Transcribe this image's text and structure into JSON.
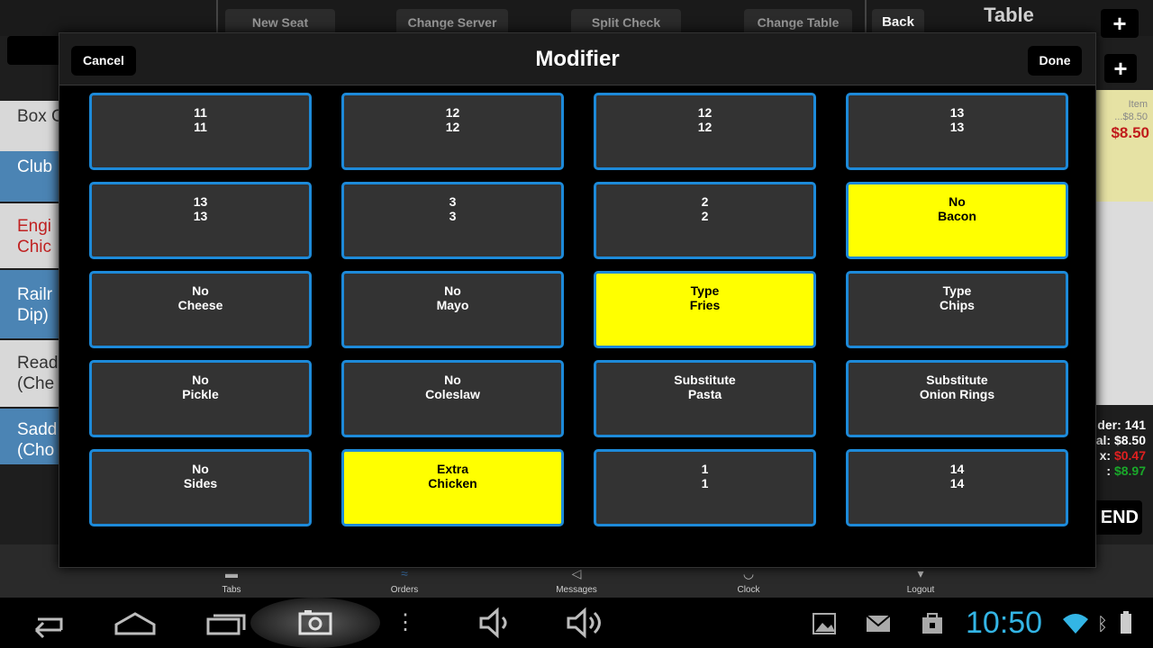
{
  "app": {
    "top_buttons": [
      "New Seat",
      "Change Server",
      "Split Check",
      "Change Table"
    ],
    "back_label": "Back",
    "table_title": "Table",
    "plus_label": "+",
    "menu_items": [
      {
        "lines": [
          "Box C"
        ],
        "style": "light"
      },
      {
        "lines": [
          "Club"
        ],
        "style": "blue"
      },
      {
        "lines": [
          "Engi",
          "Chic"
        ],
        "style": "red"
      },
      {
        "lines": [
          "Railr",
          "Dip)"
        ],
        "style": "blue"
      },
      {
        "lines": [
          "Read",
          "(Che"
        ],
        "style": "light"
      },
      {
        "lines": [
          "Sadd",
          "(Cho"
        ],
        "style": "blue"
      }
    ],
    "order_panel": {
      "item_label": "Item",
      "item_small_price": "...$8.50",
      "item_price": "$8.50",
      "totals": {
        "order": "der: 141",
        "subtotal": "al: $8.50",
        "tax_label": "x: ",
        "tax": "$0.47",
        "total_label": ": ",
        "total": "$8.97"
      },
      "send_label": "END"
    },
    "bottom_tabs": [
      {
        "label": "Tabs",
        "icon": "tabs-icon"
      },
      {
        "label": "Orders",
        "icon": "orders-icon"
      },
      {
        "label": "Messages",
        "icon": "messages-icon"
      },
      {
        "label": "Clock",
        "icon": "clock-icon"
      },
      {
        "label": "Logout",
        "icon": "logout-icon"
      }
    ]
  },
  "modal": {
    "title": "Modifier",
    "cancel_label": "Cancel",
    "done_label": "Done",
    "buttons": [
      {
        "line1": "11",
        "line2": "11",
        "selected": false
      },
      {
        "line1": "12",
        "line2": "12",
        "selected": false
      },
      {
        "line1": "12",
        "line2": "12",
        "selected": false
      },
      {
        "line1": "13",
        "line2": "13",
        "selected": false
      },
      {
        "line1": "13",
        "line2": "13",
        "selected": false
      },
      {
        "line1": "3",
        "line2": "3",
        "selected": false
      },
      {
        "line1": "2",
        "line2": "2",
        "selected": false
      },
      {
        "line1": "No",
        "line2": "Bacon",
        "selected": true
      },
      {
        "line1": "No",
        "line2": "Cheese",
        "selected": false
      },
      {
        "line1": "No",
        "line2": "Mayo",
        "selected": false
      },
      {
        "line1": "Type",
        "line2": "Fries",
        "selected": true
      },
      {
        "line1": "Type",
        "line2": "Chips",
        "selected": false
      },
      {
        "line1": "No",
        "line2": "Pickle",
        "selected": false
      },
      {
        "line1": "No",
        "line2": "Coleslaw",
        "selected": false
      },
      {
        "line1": "Substitute",
        "line2": "Pasta",
        "selected": false
      },
      {
        "line1": "Substitute",
        "line2": "Onion Rings",
        "selected": false
      },
      {
        "line1": "No",
        "line2": "Sides",
        "selected": false
      },
      {
        "line1": "Extra",
        "line2": "Chicken",
        "selected": true
      },
      {
        "line1": "1",
        "line2": "1",
        "selected": false
      },
      {
        "line1": "14",
        "line2": "14",
        "selected": false
      }
    ]
  },
  "system_bar": {
    "time": "10:50",
    "accent_color": "#33b5e5",
    "icons": [
      "back-icon",
      "home-icon",
      "recent-apps-icon",
      "screenshot-icon",
      "menu-icon",
      "volume-down-icon",
      "volume-up-icon",
      "gallery-icon",
      "gmail-icon",
      "store-icon",
      "wifi-icon",
      "bluetooth-icon",
      "battery-icon"
    ]
  }
}
